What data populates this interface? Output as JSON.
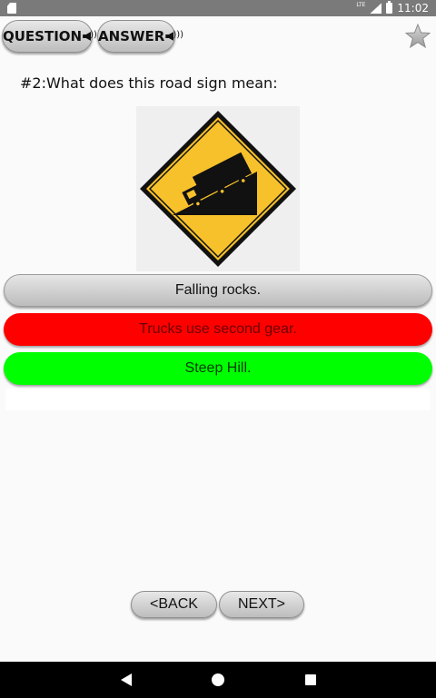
{
  "status_bar": {
    "network_label": "LTE",
    "time": "11:02"
  },
  "toolbar": {
    "question_label": "QUESTION",
    "answer_label": "ANSWER",
    "favorite_icon": "star-icon"
  },
  "question": {
    "text": "#2:What does this road sign mean:"
  },
  "sign": {
    "icon": "steep-hill-truck-sign",
    "colors": {
      "fill": "#f7c12b",
      "border": "#111111"
    }
  },
  "answers": [
    {
      "label": "Falling rocks.",
      "state": "neutral",
      "color": "#cfcfcf"
    },
    {
      "label": "Trucks use second gear.",
      "state": "wrong",
      "color": "#ff0000"
    },
    {
      "label": "Steep Hill.",
      "state": "correct",
      "color": "#00ff00"
    }
  ],
  "navigation": {
    "back_label": "<BACK",
    "next_label": "NEXT>"
  },
  "system_nav": {
    "back_icon": "triangle-back-icon",
    "home_icon": "circle-home-icon",
    "recents_icon": "square-recents-icon"
  }
}
